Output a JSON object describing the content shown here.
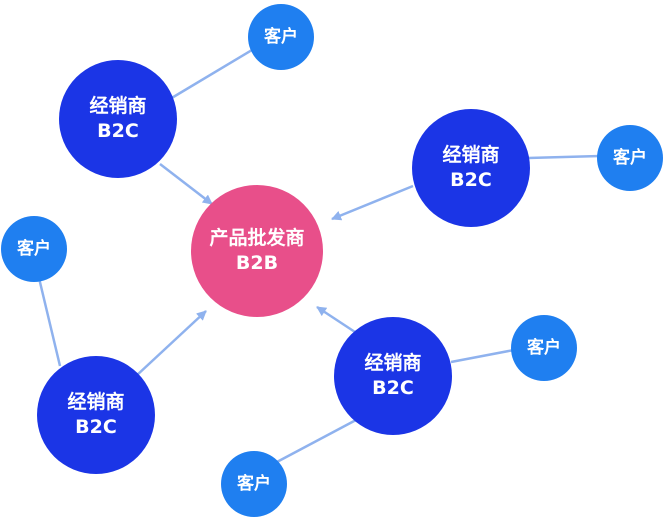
{
  "colors": {
    "center_fill": "#e84f8a",
    "distributor_fill": "#1b35e6",
    "customer_fill": "#1f7ff0",
    "connector": "#8fb2ee"
  },
  "center": {
    "line1": "产品批发商",
    "line2": "B2B"
  },
  "distributors": [
    {
      "line1": "经销商",
      "line2": "B2C"
    },
    {
      "line1": "经销商",
      "line2": "B2C"
    },
    {
      "line1": "经销商",
      "line2": "B2C"
    },
    {
      "line1": "经销商",
      "line2": "B2C"
    }
  ],
  "customers": [
    {
      "label": "客户"
    },
    {
      "label": "客户"
    },
    {
      "label": "客户"
    },
    {
      "label": "客户"
    },
    {
      "label": "客户"
    }
  ]
}
